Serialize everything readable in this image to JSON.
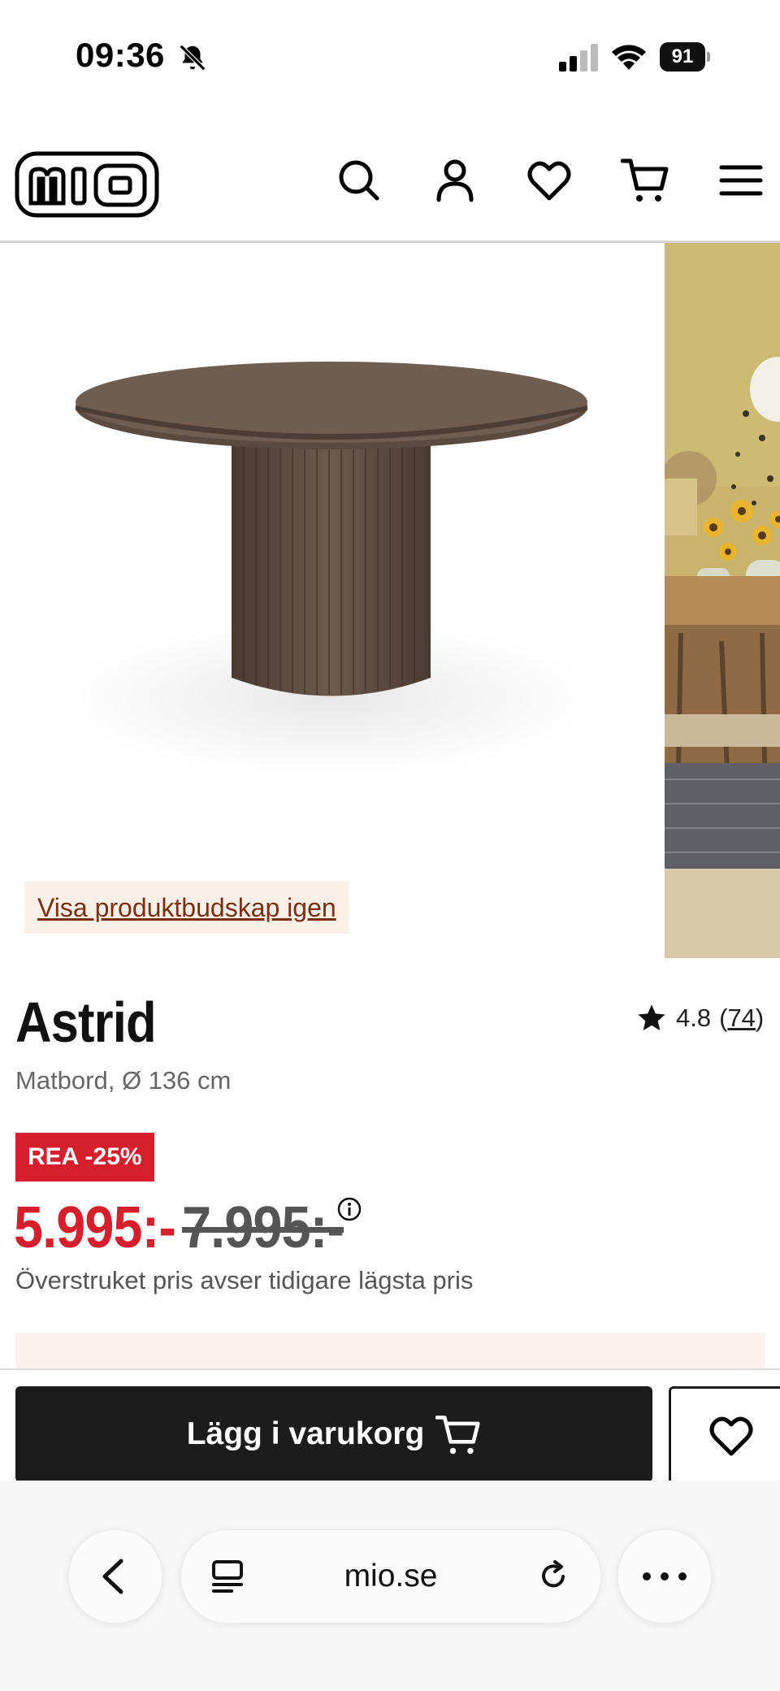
{
  "status_bar": {
    "time": "09:36",
    "battery": "91"
  },
  "header": {
    "logo_alt": "mio",
    "icons": [
      "search-icon",
      "account-icon",
      "heart-icon",
      "cart-icon",
      "menu-icon"
    ]
  },
  "gallery": {
    "message_link": "Visa produktbudskap igen"
  },
  "product": {
    "name": "Astrid",
    "rating": "4.8",
    "review_count": "74",
    "subtitle": "Matbord, Ø 136 cm",
    "sale_badge": "REA -25%",
    "price": "5.995:-",
    "old_price": "7.995:-",
    "price_note": "Överstruket pris avser tidigare lägsta pris"
  },
  "actions": {
    "add_to_cart": "Lägg i varukorg"
  },
  "browser": {
    "url": "mio.se"
  },
  "colors": {
    "sale_red": "#d61f2c",
    "button_dark": "#1c1c1c",
    "message_bg": "#fbf0e8"
  }
}
